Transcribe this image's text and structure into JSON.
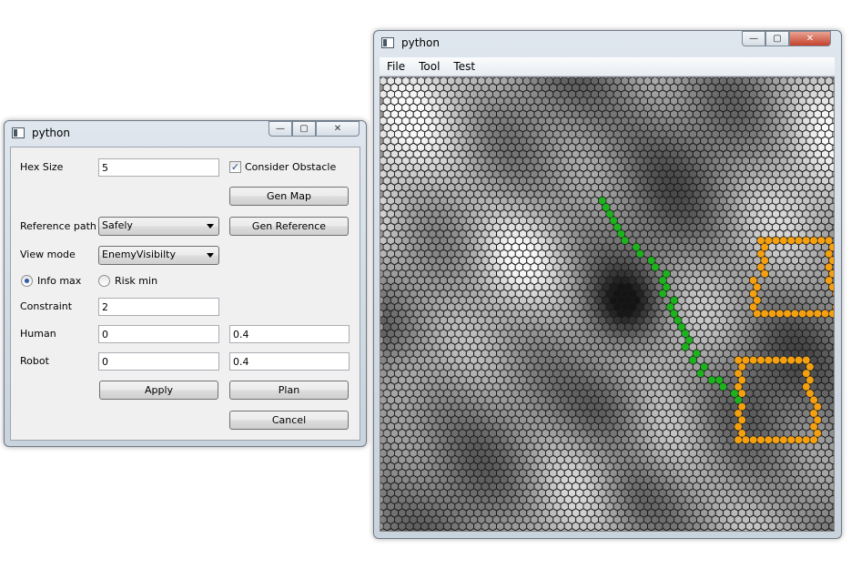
{
  "dialog": {
    "title": "python",
    "hex_size": {
      "label": "Hex Size",
      "value": "5"
    },
    "consider_obstacle": {
      "label": "Consider Obstacle",
      "checked": true
    },
    "gen_map_label": "Gen Map",
    "reference_path": {
      "label": "Reference path",
      "selected": "Safely"
    },
    "gen_reference_label": "Gen Reference",
    "view_mode": {
      "label": "View mode",
      "selected": "EnemyVisibilty"
    },
    "info_max": {
      "label": "Info max",
      "selected": true
    },
    "risk_min": {
      "label": "Risk min",
      "selected": false
    },
    "constraint": {
      "label": "Constraint",
      "value": "2"
    },
    "human": {
      "label": "Human",
      "value1": "0",
      "value2": "0.4"
    },
    "robot": {
      "label": "Robot",
      "value1": "0",
      "value2": "0.4"
    },
    "apply_label": "Apply",
    "plan_label": "Plan",
    "cancel_label": "Cancel"
  },
  "map_window": {
    "title": "python",
    "menu": [
      "File",
      "Tool",
      "Test"
    ],
    "colors": {
      "path": "#1db31d",
      "obstacle": "#f5a00f",
      "hex_outline": "#1a1a1a"
    },
    "path_hexes": [
      [
        48,
        47
      ],
      [
        47,
        46
      ],
      [
        46,
        45
      ],
      [
        45,
        44
      ],
      [
        45,
        43
      ],
      [
        44,
        42
      ],
      [
        43,
        42
      ],
      [
        42,
        41
      ],
      [
        41,
        41
      ],
      [
        40,
        40
      ],
      [
        39,
        40
      ],
      [
        38,
        40
      ],
      [
        37,
        39
      ],
      [
        36,
        39
      ],
      [
        35,
        38
      ],
      [
        34,
        38
      ],
      [
        33,
        38
      ],
      [
        32,
        37
      ],
      [
        31,
        37
      ],
      [
        30,
        37
      ],
      [
        29,
        37
      ],
      [
        28,
        36
      ],
      [
        27,
        35
      ],
      [
        26,
        34
      ],
      [
        25,
        33
      ],
      [
        24,
        32
      ],
      [
        23,
        31
      ],
      [
        22,
        31
      ],
      [
        21,
        30
      ],
      [
        20,
        30
      ],
      [
        19,
        29
      ],
      [
        18,
        29
      ]
    ],
    "obstacle_hexes": [
      [
        42,
        47
      ],
      [
        42,
        48
      ],
      [
        42,
        49
      ],
      [
        42,
        50
      ],
      [
        42,
        51
      ],
      [
        42,
        52
      ],
      [
        42,
        53
      ],
      [
        42,
        54
      ],
      [
        42,
        55
      ],
      [
        42,
        56
      ],
      [
        43,
        47
      ],
      [
        43,
        56
      ],
      [
        44,
        47
      ],
      [
        44,
        56
      ],
      [
        45,
        47
      ],
      [
        45,
        56
      ],
      [
        46,
        47
      ],
      [
        46,
        56
      ],
      [
        47,
        47
      ],
      [
        47,
        56
      ],
      [
        48,
        47
      ],
      [
        48,
        57
      ],
      [
        49,
        47
      ],
      [
        49,
        57
      ],
      [
        50,
        47
      ],
      [
        50,
        57
      ],
      [
        51,
        47
      ],
      [
        51,
        57
      ],
      [
        52,
        47
      ],
      [
        52,
        57
      ],
      [
        53,
        47
      ],
      [
        53,
        57
      ],
      [
        54,
        47
      ],
      [
        54,
        48
      ],
      [
        54,
        49
      ],
      [
        54,
        50
      ],
      [
        54,
        51
      ],
      [
        54,
        52
      ],
      [
        54,
        53
      ],
      [
        54,
        54
      ],
      [
        54,
        55
      ],
      [
        54,
        56
      ],
      [
        54,
        57
      ],
      [
        24,
        50
      ],
      [
        24,
        51
      ],
      [
        24,
        52
      ],
      [
        24,
        53
      ],
      [
        24,
        54
      ],
      [
        24,
        55
      ],
      [
        24,
        56
      ],
      [
        24,
        57
      ],
      [
        24,
        58
      ],
      [
        24,
        59
      ],
      [
        25,
        50
      ],
      [
        25,
        59
      ],
      [
        26,
        50
      ],
      [
        26,
        59
      ],
      [
        27,
        50
      ],
      [
        27,
        59
      ],
      [
        28,
        50
      ],
      [
        28,
        59
      ],
      [
        29,
        50
      ],
      [
        29,
        59
      ],
      [
        30,
        49
      ],
      [
        30,
        59
      ],
      [
        31,
        49
      ],
      [
        31,
        59
      ],
      [
        32,
        49
      ],
      [
        32,
        60
      ],
      [
        33,
        49
      ],
      [
        33,
        60
      ],
      [
        34,
        49
      ],
      [
        34,
        60
      ],
      [
        35,
        49
      ],
      [
        35,
        50
      ],
      [
        35,
        51
      ],
      [
        35,
        52
      ],
      [
        35,
        53
      ],
      [
        35,
        54
      ],
      [
        35,
        55
      ],
      [
        35,
        56
      ],
      [
        35,
        57
      ],
      [
        35,
        58
      ],
      [
        35,
        59
      ],
      [
        35,
        60
      ]
    ]
  }
}
